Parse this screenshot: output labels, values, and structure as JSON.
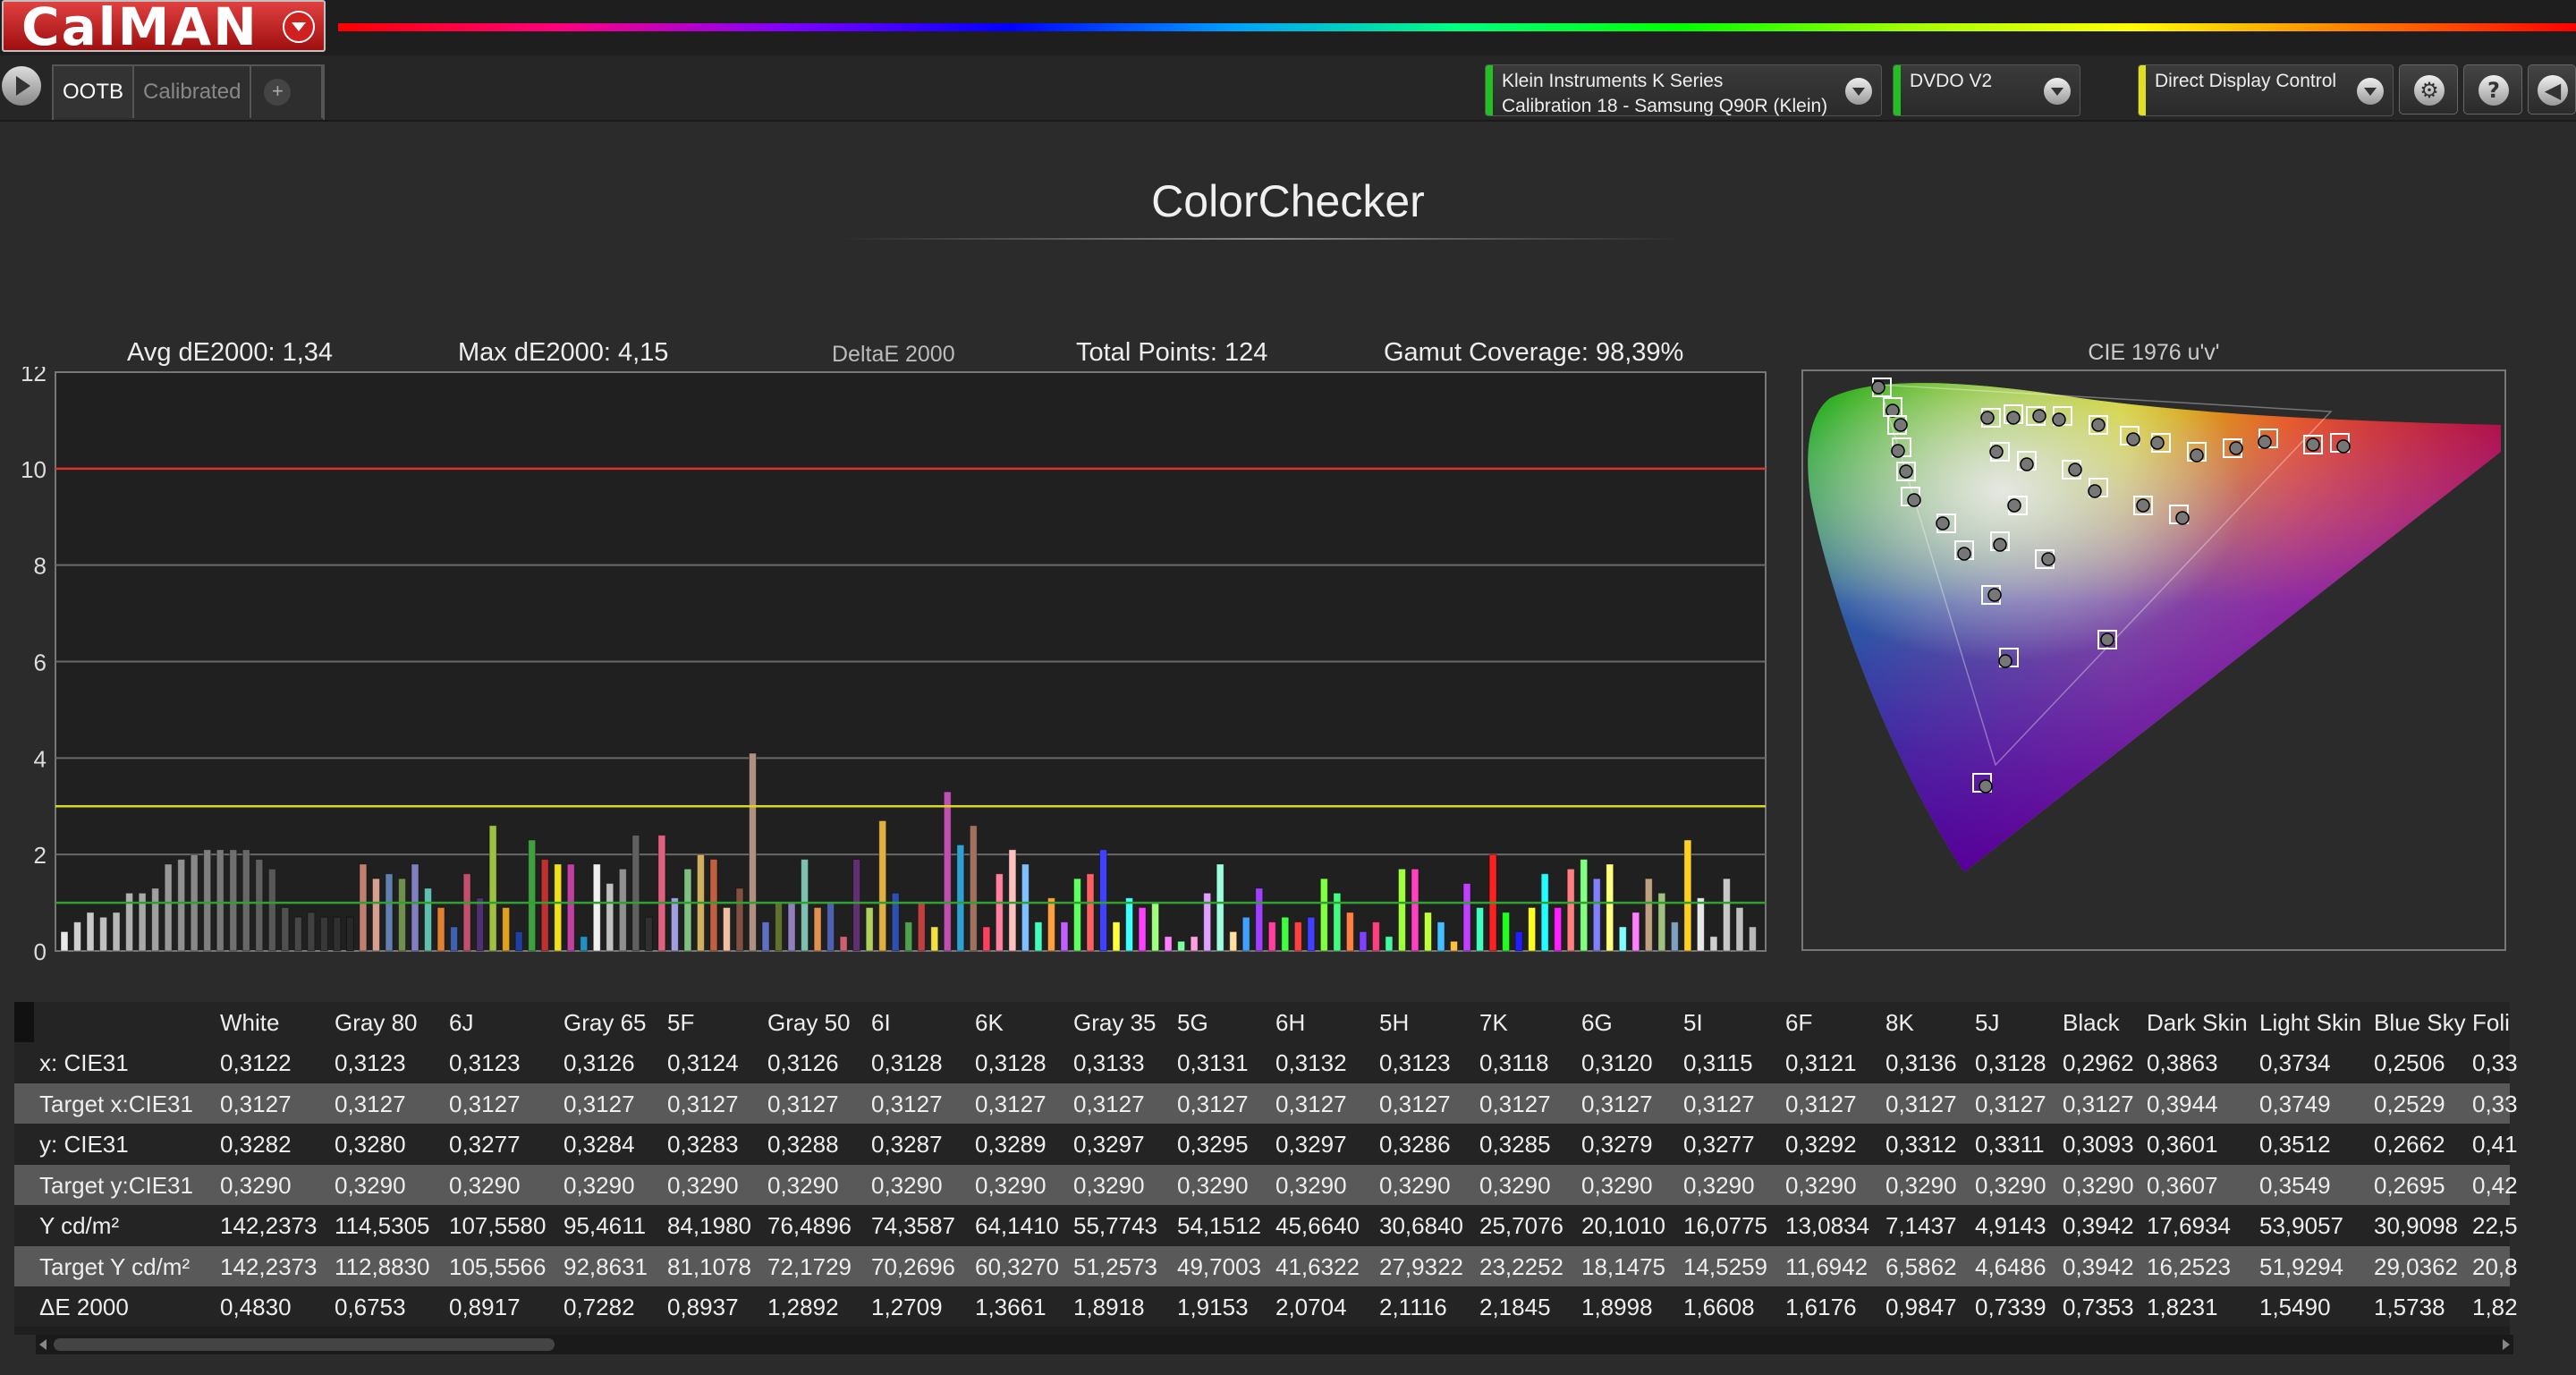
{
  "app": {
    "logo": "CalMAN"
  },
  "toolbar": {
    "tabs": [
      {
        "label": "OOTB",
        "active": true
      },
      {
        "label": "Calibrated",
        "active": false
      }
    ],
    "add_tab": "+",
    "devices": [
      {
        "line1": "Klein Instruments K Series",
        "line2": "Calibration 18 - Samsung Q90R (Klein)",
        "color": "#22c022"
      },
      {
        "line1": "DVDO V2",
        "line2": "",
        "color": "#22c022"
      },
      {
        "line1": "Direct Display Control",
        "line2": "",
        "color": "#e0e020"
      }
    ],
    "help": "?"
  },
  "page": {
    "title": "ColorChecker"
  },
  "stats": {
    "avg": "Avg dE2000: 1,34",
    "max": "Max dE2000: 4,15",
    "metric": "DeltaE 2000",
    "total": "Total Points: 124",
    "gamut": "Gamut Coverage: 98,39%"
  },
  "cie": {
    "title": "CIE 1976 u'v'"
  },
  "chart_data": {
    "type": "bar",
    "title": "",
    "ylabel": "",
    "ylim": [
      0,
      12
    ],
    "yticks": [
      "0",
      "2",
      "4",
      "6",
      "8",
      "10",
      "12"
    ],
    "threshold_lines": [
      {
        "value": 10,
        "color": "#e03030"
      },
      {
        "value": 3,
        "color": "#d8d820"
      },
      {
        "value": 1,
        "color": "#30a030"
      }
    ],
    "values": [
      0.4,
      0.6,
      0.8,
      0.7,
      0.8,
      1.2,
      1.2,
      1.3,
      1.8,
      1.9,
      2.0,
      2.1,
      2.1,
      2.1,
      2.1,
      1.9,
      1.7,
      0.9,
      0.7,
      0.8,
      0.7,
      0.7,
      0.7,
      1.8,
      1.5,
      1.6,
      1.5,
      1.8,
      1.3,
      0.9,
      0.5,
      1.6,
      1.1,
      2.6,
      0.9,
      0.4,
      2.3,
      1.9,
      1.8,
      1.8,
      0.3,
      1.8,
      1.4,
      1.7,
      2.4,
      0.7,
      2.4,
      1.1,
      1.7,
      2.0,
      1.9,
      0.9,
      1.3,
      4.1,
      0.6,
      1.0,
      1.0,
      1.9,
      0.9,
      1.0,
      0.3,
      1.9,
      0.9,
      2.7,
      1.2,
      0.6,
      1.0,
      0.5,
      3.3,
      2.2,
      2.6,
      0.5,
      1.6,
      2.1,
      1.8,
      0.6,
      1.1,
      0.6,
      1.5,
      1.6,
      2.1,
      0.6,
      1.1,
      0.9,
      1.0,
      0.3,
      0.2,
      0.3,
      1.2,
      1.8,
      0.4,
      0.7,
      1.3,
      0.6,
      0.7,
      0.6,
      0.7,
      1.5,
      1.2,
      0.8,
      0.4,
      0.6,
      0.3,
      1.7,
      1.7,
      0.8,
      0.6,
      0.2,
      1.4,
      0.9,
      2.0,
      0.8,
      0.4,
      0.9,
      1.6,
      0.9,
      1.7,
      1.9,
      1.5,
      1.8,
      0.5,
      0.8,
      1.5,
      1.2,
      0.6,
      2.3,
      1.1,
      0.3,
      1.5,
      0.9,
      0.5
    ],
    "colors": [
      "#e8e8e8",
      "#d0d0d0",
      "#c8c8c8",
      "#c0c0c0",
      "#b8b8b8",
      "#b0b0b0",
      "#a8a8a8",
      "#a0a0a0",
      "#989898",
      "#909090",
      "#888888",
      "#808080",
      "#787878",
      "#707070",
      "#686868",
      "#606060",
      "#585858",
      "#505050",
      "#484848",
      "#404040",
      "#383838",
      "#303030",
      "#282828",
      "#c08070",
      "#d8a090",
      "#6080b0",
      "#709050",
      "#8080c0",
      "#60c0b0",
      "#e08030",
      "#4060b0",
      "#c05070",
      "#503070",
      "#a0c040",
      "#e0a020",
      "#2040a0",
      "#40a040",
      "#c03030",
      "#f0e020",
      "#c040a0",
      "#2090c0",
      "#f0f0f0",
      "#c0c0c0",
      "#909090",
      "#606060",
      "#303030",
      "#e06080",
      "#a0a0e0",
      "#80c080",
      "#d0b060",
      "#c06040",
      "#f0c0a0",
      "#805040",
      "#b09080",
      "#6070c0",
      "#607030",
      "#9080c0",
      "#80c0b0",
      "#e09050",
      "#5060b0",
      "#d06070",
      "#603070",
      "#b0d060",
      "#e0b040",
      "#3050b0",
      "#50a050",
      "#c04040",
      "#f0e040",
      "#c050b0",
      "#30a0d0",
      "#a07060",
      "#ff4060",
      "#ff80a0",
      "#ffc0c0",
      "#80c0ff",
      "#40ffc0",
      "#ffa040",
      "#c060ff",
      "#60ff60",
      "#ff6060",
      "#4040ff",
      "#ffff40",
      "#40ffff",
      "#ff40ff",
      "#a0ff80",
      "#ff80ff",
      "#80ffa0",
      "#ffa0e0",
      "#e0a0ff",
      "#a0ffe0",
      "#ffe0a0",
      "#40a0ff",
      "#a040ff",
      "#ff40a0",
      "#40ff40",
      "#ff4040",
      "#4040ff",
      "#80ff40",
      "#40ff80",
      "#ff8040",
      "#8040ff",
      "#ff4080",
      "#40ffa0",
      "#a0ff40",
      "#ff40c0",
      "#c0ff40",
      "#40c0ff",
      "#ffc040",
      "#c040ff",
      "#40ffc0",
      "#ff2020",
      "#20ff20",
      "#2020ff",
      "#ffff20",
      "#20ffff",
      "#ff20ff",
      "#ff8080",
      "#80ff80",
      "#8080ff",
      "#ffff80",
      "#80ffff",
      "#ff80ff",
      "#c0a080",
      "#a0c080",
      "#80a0c0",
      "#ffd020"
    ]
  },
  "table": {
    "columns": [
      "White",
      "Gray 80",
      "6J",
      "Gray 65",
      "5F",
      "Gray 50",
      "6I",
      "6K",
      "Gray 35",
      "5G",
      "6H",
      "5H",
      "7K",
      "6G",
      "5I",
      "6F",
      "8K",
      "5J",
      "Black",
      "Dark Skin",
      "Light Skin",
      "Blue Sky",
      "Foli"
    ],
    "rows": [
      {
        "label": "x: CIE31",
        "values": [
          "0,3122",
          "0,3123",
          "0,3123",
          "0,3126",
          "0,3124",
          "0,3126",
          "0,3128",
          "0,3128",
          "0,3133",
          "0,3131",
          "0,3132",
          "0,3123",
          "0,3118",
          "0,3120",
          "0,3115",
          "0,3121",
          "0,3136",
          "0,3128",
          "0,2962",
          "0,3863",
          "0,3734",
          "0,2506",
          "0,33"
        ]
      },
      {
        "label": "Target x:CIE31",
        "values": [
          "0,3127",
          "0,3127",
          "0,3127",
          "0,3127",
          "0,3127",
          "0,3127",
          "0,3127",
          "0,3127",
          "0,3127",
          "0,3127",
          "0,3127",
          "0,3127",
          "0,3127",
          "0,3127",
          "0,3127",
          "0,3127",
          "0,3127",
          "0,3127",
          "0,3127",
          "0,3944",
          "0,3749",
          "0,2529",
          "0,33"
        ]
      },
      {
        "label": "y: CIE31",
        "values": [
          "0,3282",
          "0,3280",
          "0,3277",
          "0,3284",
          "0,3283",
          "0,3288",
          "0,3287",
          "0,3289",
          "0,3297",
          "0,3295",
          "0,3297",
          "0,3286",
          "0,3285",
          "0,3279",
          "0,3277",
          "0,3292",
          "0,3312",
          "0,3311",
          "0,3093",
          "0,3601",
          "0,3512",
          "0,2662",
          "0,41"
        ]
      },
      {
        "label": "Target y:CIE31",
        "values": [
          "0,3290",
          "0,3290",
          "0,3290",
          "0,3290",
          "0,3290",
          "0,3290",
          "0,3290",
          "0,3290",
          "0,3290",
          "0,3290",
          "0,3290",
          "0,3290",
          "0,3290",
          "0,3290",
          "0,3290",
          "0,3290",
          "0,3290",
          "0,3290",
          "0,3290",
          "0,3607",
          "0,3549",
          "0,2695",
          "0,42"
        ]
      },
      {
        "label": "Y cd/m²",
        "values": [
          "142,2373",
          "114,5305",
          "107,5580",
          "95,4611",
          "84,1980",
          "76,4896",
          "74,3587",
          "64,1410",
          "55,7743",
          "54,1512",
          "45,6640",
          "30,6840",
          "25,7076",
          "20,1010",
          "16,0775",
          "13,0834",
          "7,1437",
          "4,9143",
          "0,3942",
          "17,6934",
          "53,9057",
          "30,9098",
          "22,5"
        ]
      },
      {
        "label": "Target Y cd/m²",
        "values": [
          "142,2373",
          "112,8830",
          "105,5566",
          "92,8631",
          "81,1078",
          "72,1729",
          "70,2696",
          "60,3270",
          "51,2573",
          "49,7003",
          "41,6322",
          "27,9322",
          "23,2252",
          "18,1475",
          "14,5259",
          "11,6942",
          "6,5862",
          "4,6486",
          "0,3942",
          "16,2523",
          "51,9294",
          "29,0362",
          "20,8"
        ]
      },
      {
        "label": "ΔE 2000",
        "values": [
          "0,4830",
          "0,6753",
          "0,8917",
          "0,7282",
          "0,8937",
          "1,2892",
          "1,2709",
          "1,3661",
          "1,8918",
          "1,9153",
          "2,0704",
          "2,1116",
          "2,1845",
          "1,8998",
          "1,6608",
          "1,6176",
          "0,9847",
          "0,7339",
          "0,7353",
          "1,8231",
          "1,5490",
          "1,5738",
          "1,82"
        ]
      }
    ]
  }
}
